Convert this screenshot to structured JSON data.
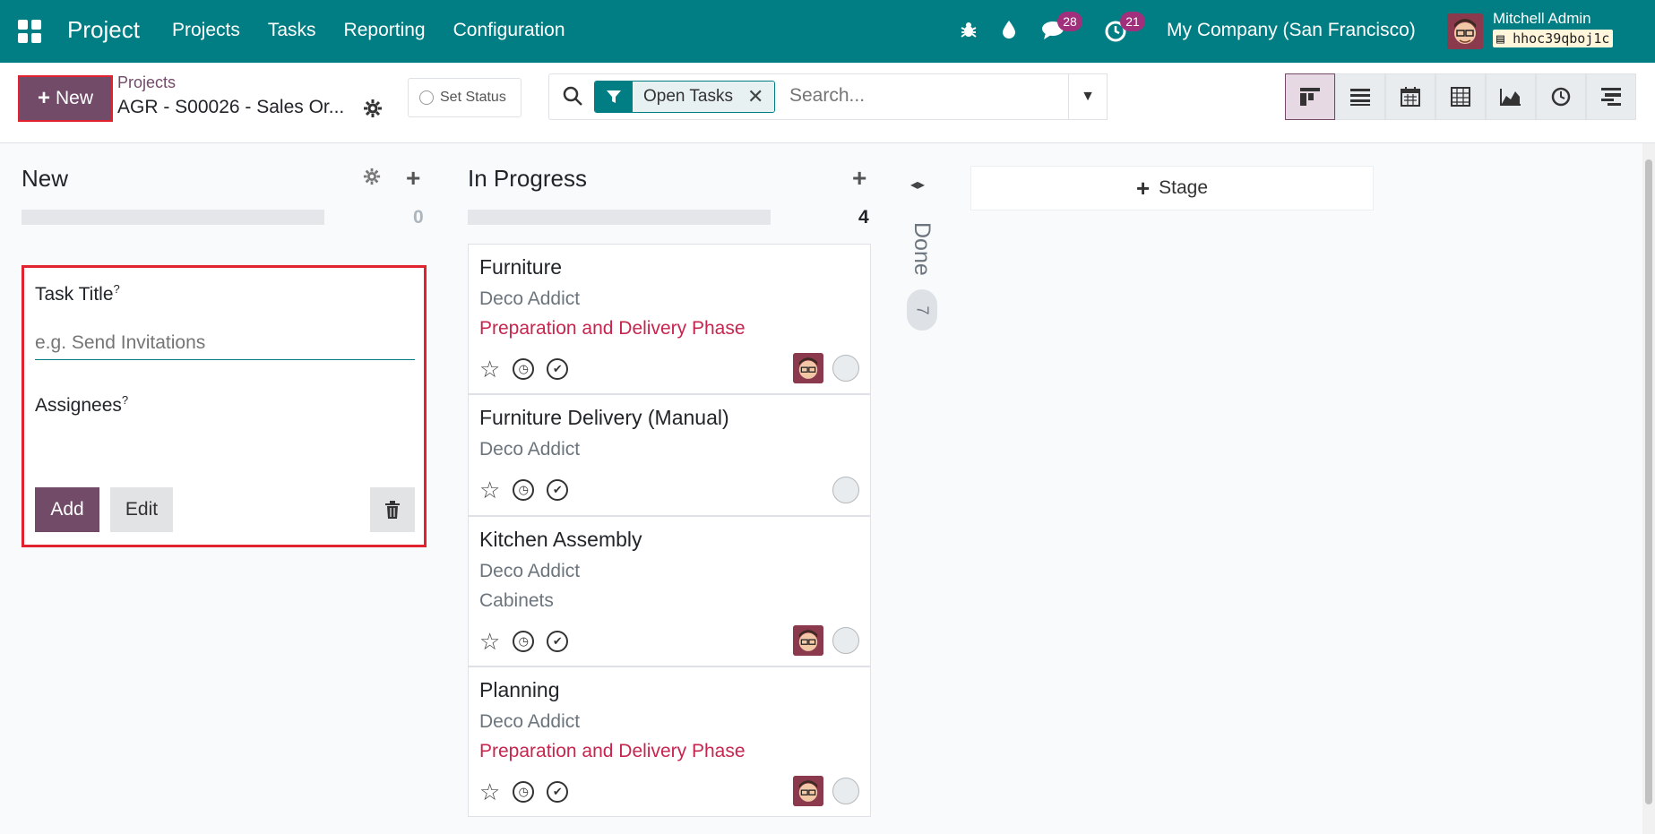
{
  "navbar": {
    "app_name": "Project",
    "menu": [
      "Projects",
      "Tasks",
      "Reporting",
      "Configuration"
    ],
    "messages_count": "28",
    "activities_count": "21",
    "company": "My Company (San Francisco)",
    "user_name": "Mitchell Admin",
    "db_name": "hhoc39qboj1c",
    "db_icon": "database-icon",
    "bg_color": "#017e84"
  },
  "control_panel": {
    "new_label": "New",
    "breadcrumb_parent": "Projects",
    "breadcrumb_current": "AGR - S00026 - Sales Or...",
    "set_status_label": "Set Status",
    "search": {
      "facet_label": "Open Tasks",
      "placeholder": "Search..."
    }
  },
  "kanban": {
    "columns": [
      {
        "title": "New",
        "count": "0"
      },
      {
        "title": "In Progress",
        "count": "4"
      }
    ],
    "quick_create": {
      "task_title_label": "Task Title",
      "task_title_placeholder": "e.g. Send Invitations",
      "assignees_label": "Assignees",
      "help_mark": "?",
      "add_label": "Add",
      "edit_label": "Edit"
    },
    "cards": [
      {
        "title": "Furniture",
        "partner": "Deco Addict",
        "tag": "Preparation and Delivery Phase",
        "tag_color": "#c7254e",
        "has_avatar": true
      },
      {
        "title": "Furniture Delivery (Manual)",
        "partner": "Deco Addict",
        "tag": "",
        "has_avatar": false
      },
      {
        "title": "Kitchen Assembly",
        "partner": "Deco Addict",
        "tag": "Cabinets",
        "tag_color": "#6c757d",
        "has_avatar": true
      },
      {
        "title": "Planning",
        "partner": "Deco Addict",
        "tag": "Preparation and Delivery Phase",
        "tag_color": "#c7254e",
        "has_avatar": true
      }
    ],
    "folded_column": {
      "title": "Done",
      "count": "7"
    },
    "add_stage_label": "Stage"
  },
  "colors": {
    "primary": "#714b67",
    "teal": "#017e84",
    "highlight_border": "#e0232f"
  }
}
